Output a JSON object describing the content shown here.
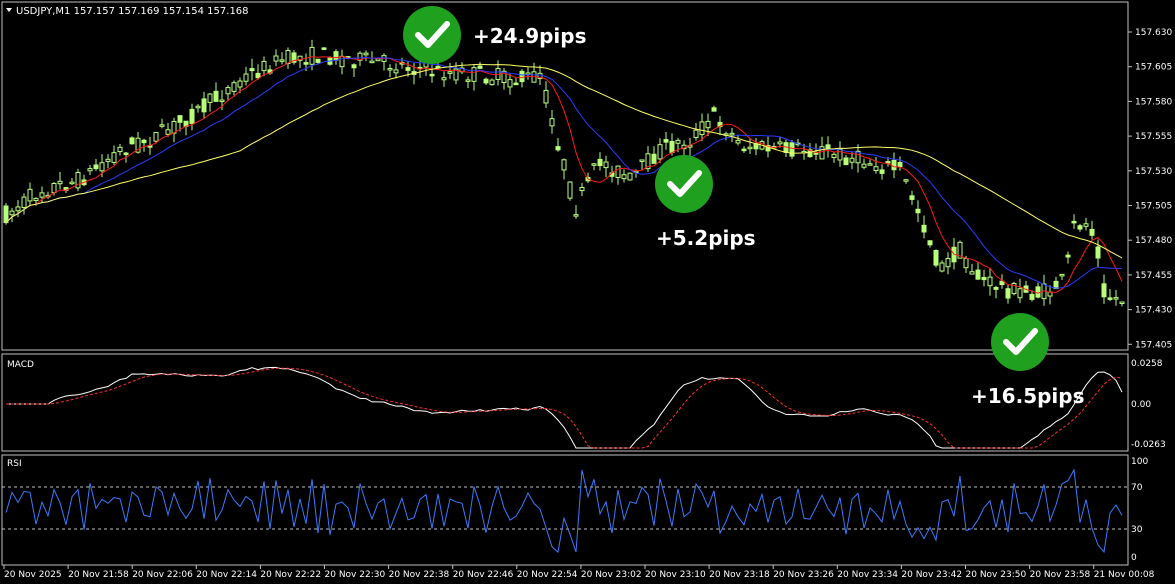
{
  "symbol_header": "USDJPY,M1  157.157 157.169 157.154 157.168",
  "main_price_ticks": [
    "157.630",
    "157.605",
    "157.580",
    "157.555",
    "157.530",
    "157.505",
    "157.480",
    "157.455",
    "157.430",
    "157.405"
  ],
  "macd_panel": {
    "label": "MACD",
    "ticks": [
      "0.0258",
      "0.00",
      "-0.0263"
    ]
  },
  "rsi_panel": {
    "label": "RSI",
    "ticks": [
      "100",
      "70",
      "30",
      "0"
    ]
  },
  "time_axis": [
    "20 Nov 2025",
    "20 Nov 21:58",
    "20 Nov 22:06",
    "20 Nov 22:14",
    "20 Nov 22:22",
    "20 Nov 22:30",
    "20 Nov 22:38",
    "20 Nov 22:46",
    "20 Nov 22:54",
    "20 Nov 23:02",
    "20 Nov 23:10",
    "20 Nov 23:18",
    "20 Nov 23:26",
    "20 Nov 23:34",
    "20 Nov 23:42",
    "20 Nov 23:50",
    "20 Nov 23:58",
    "21 Nov 00:08"
  ],
  "trade_annotations": [
    {
      "label": "+24.9pips",
      "icon": "check-circle-icon"
    },
    {
      "label": "+5.2pips",
      "icon": "check-circle-icon"
    },
    {
      "label": "+16.5pips",
      "icon": "check-circle-icon"
    }
  ],
  "colors": {
    "background": "#000000",
    "grid_border": "#c0c0c0",
    "candle": "#b8ff7a",
    "ma_fast": "#ff1a1a",
    "ma_mid": "#2a3cff",
    "ma_slow": "#ffff66",
    "macd_line": "#ffffff",
    "macd_signal": "#ff3030",
    "rsi_line": "#3a7bff",
    "badge_green": "#1fa01f",
    "annotation_text": "#ffffff",
    "axis_text": "#ffffff"
  }
}
